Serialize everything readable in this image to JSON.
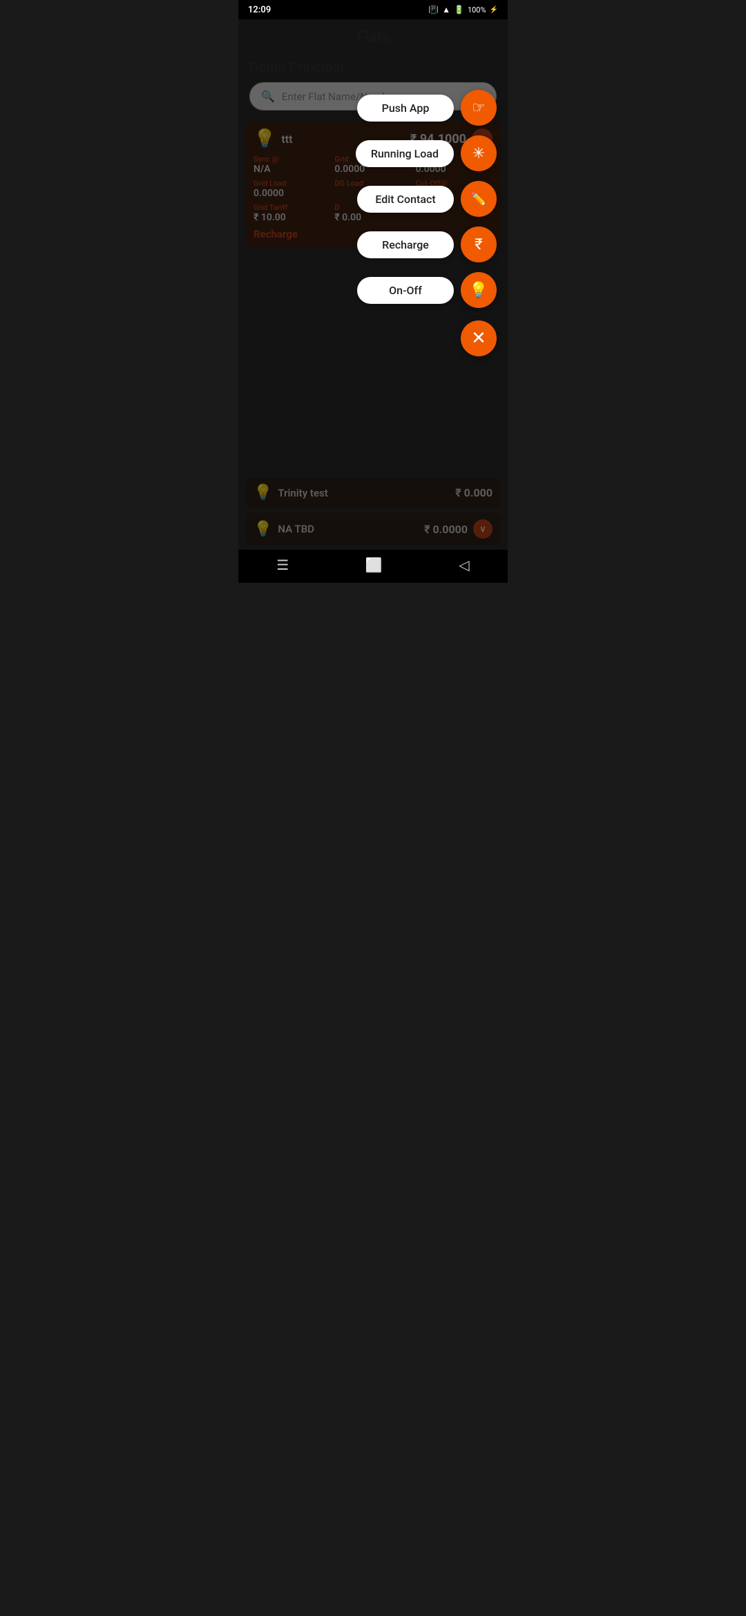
{
  "statusBar": {
    "time": "12:09",
    "battery": "100%"
  },
  "header": {
    "backLabel": "<",
    "title": "Flats"
  },
  "sectionTitle": "Demo Principal",
  "search": {
    "placeholder": "Enter Flat Name/Number"
  },
  "flatCard": {
    "name": "ttt",
    "amount": "₹ 94.1000",
    "syncLabel": "Sync @",
    "syncValue": "N/A",
    "gridLabel": "Grid",
    "gridValue": "0.0000",
    "dcLabel": "DC",
    "dcValue": "0.0000",
    "gridLoadLabel": "Grid Load",
    "gridLoadValue": "0.0000",
    "dgLoadLabel": "DG Load",
    "dgLoadValue": "",
    "cutOffLabel": "Cut-Off@",
    "cutOffValue": "",
    "gridTariffLabel": "Grid Tariff",
    "gridTariffValue": "₹ 10.00",
    "dLabel": "D",
    "dValue": "₹ 0.00",
    "rechargeLabel": "Recharge"
  },
  "fabMenu": {
    "items": [
      {
        "id": "push-app",
        "label": "Push App",
        "icon": "👆"
      },
      {
        "id": "running-load",
        "label": "Running Load",
        "icon": "✳"
      },
      {
        "id": "edit-contact",
        "label": "Edit Contact",
        "icon": "✏"
      },
      {
        "id": "recharge",
        "label": "Recharge",
        "icon": "₹"
      },
      {
        "id": "on-off",
        "label": "On-Off",
        "icon": "💡"
      }
    ],
    "closeIcon": "✕"
  },
  "bottomCards": [
    {
      "name": "Trinity test",
      "amount": "₹ 0.000",
      "hasChevronDown": false
    },
    {
      "name": "NA TBD",
      "amount": "₹ 0.0000",
      "hasChevronDown": true
    }
  ]
}
